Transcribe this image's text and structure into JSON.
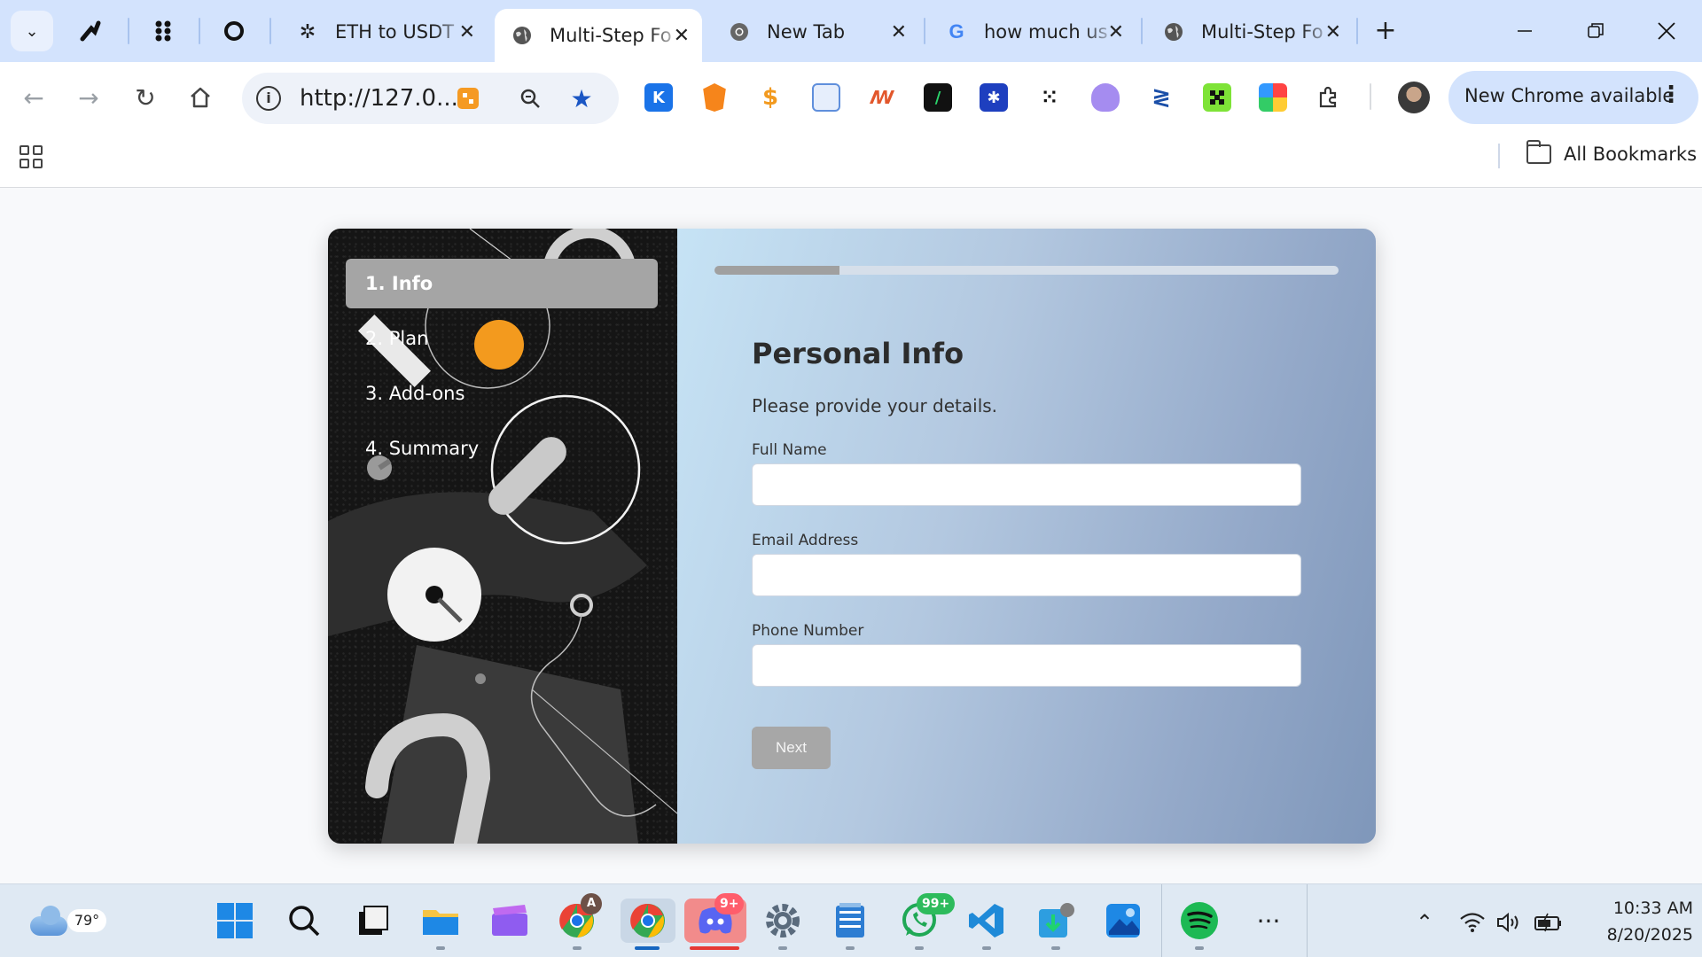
{
  "browser": {
    "tabs": [
      {
        "title": "ETH to USDT",
        "icon": "chatgpt-icon",
        "active": false
      },
      {
        "title": "Multi-Step Fo",
        "icon": "globe-icon",
        "active": true
      },
      {
        "title": "New Tab",
        "icon": "chrome-icon",
        "active": false
      },
      {
        "title": "how much us",
        "icon": "google-icon",
        "active": false
      },
      {
        "title": "Multi-Step Fo",
        "icon": "globe-icon",
        "active": false
      }
    ],
    "close_glyph": "✕",
    "new_tab_glyph": "+",
    "url": "http://127.0...",
    "update_button": "New Chrome available",
    "all_bookmarks": "All Bookmarks"
  },
  "form": {
    "steps": [
      {
        "label": "1. Info",
        "active": true
      },
      {
        "label": "2. Plan",
        "active": false
      },
      {
        "label": "3. Add-ons",
        "active": false
      },
      {
        "label": "4. Summary",
        "active": false
      }
    ],
    "progress_percent": 20,
    "title": "Personal Info",
    "subtitle": "Please provide your details.",
    "fields": [
      {
        "label": "Full Name",
        "value": ""
      },
      {
        "label": "Email Address",
        "value": ""
      },
      {
        "label": "Phone Number",
        "value": ""
      }
    ],
    "next_button": "Next"
  },
  "taskbar": {
    "weather_temp": "79°",
    "discord_badge": "9+",
    "whatsapp_badge": "99+",
    "chrome_profile_badge": "A",
    "time": "10:33 AM",
    "date": "8/20/2025"
  },
  "colors": {
    "tab_strip": "#d3e3fd",
    "sidebar_bg": "#151515",
    "step_active_bg": "#a5a5a5",
    "progress_fill": "#a0a0a0",
    "next_button_bg": "#a7a7a7",
    "panel_gradient_start": "#c6e3f5",
    "panel_gradient_end": "#7f97ba"
  }
}
